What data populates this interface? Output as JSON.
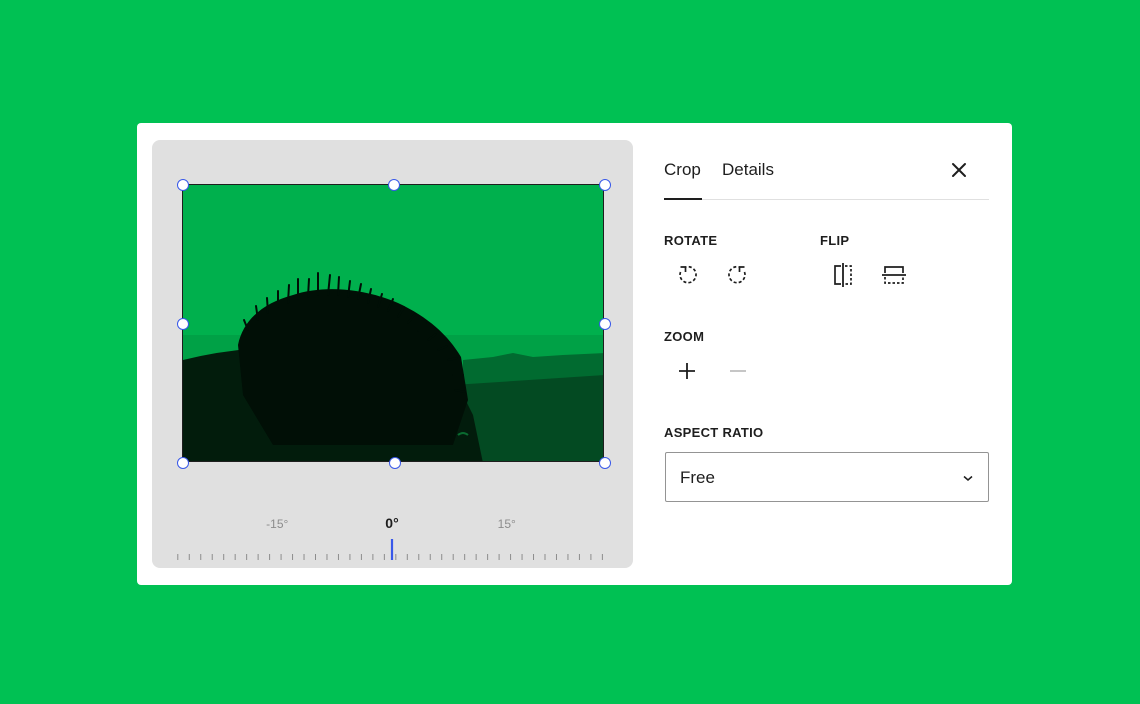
{
  "tabs": [
    {
      "label": "Crop",
      "active": true
    },
    {
      "label": "Details",
      "active": false
    }
  ],
  "sections": {
    "rotate": {
      "label": "ROTATE"
    },
    "flip": {
      "label": "FLIP"
    },
    "zoom": {
      "label": "ZOOM"
    },
    "aspect_ratio": {
      "label": "ASPECT RATIO",
      "value": "Free"
    }
  },
  "rotation_ruler": {
    "labels": [
      {
        "text": "-15°",
        "value": -15,
        "emphasis": false
      },
      {
        "text": "0°",
        "value": 0,
        "emphasis": true
      },
      {
        "text": "15°",
        "value": 15,
        "emphasis": false
      }
    ],
    "current_value": 0,
    "min": -28,
    "max": 28,
    "step": 1.5
  },
  "icons": {
    "close": "close-icon",
    "rotate_left": "rotate-left-icon",
    "rotate_right": "rotate-right-icon",
    "flip_horizontal": "flip-horizontal-icon",
    "flip_vertical": "flip-vertical-icon",
    "zoom_in": "plus-icon",
    "zoom_out": "minus-icon",
    "dropdown": "chevron-down-icon"
  },
  "colors": {
    "background": "#00c153",
    "accent": "#3858e9",
    "text": "#1e1e1e",
    "muted": "#949494",
    "canvas": "#e0e0e0"
  }
}
